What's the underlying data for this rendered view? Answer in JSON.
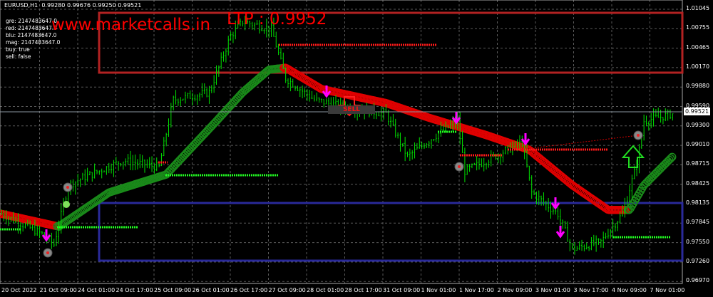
{
  "header": {
    "symbol": "EURUSD,H1",
    "open": "0.99280",
    "high": "0.99676",
    "low": "0.99250",
    "close": "0.99521"
  },
  "indicator_values": [
    "gre: 2147483647.0",
    "red: 2147483647.0",
    "blu: 2147483647.0",
    "mag: 2147483647.0",
    "buy: true",
    "sell: false"
  ],
  "watermark": "www.marketcalls.in",
  "ltp_label": "LTP : 0.9952",
  "sell_label": "SELL",
  "current_price": "0.99521",
  "price_axis": [
    "1.01045",
    "1.00755",
    "1.00465",
    "1.00170",
    "0.99880",
    "0.99590",
    "0.99300",
    "0.99010",
    "0.98715",
    "0.98425",
    "0.98135",
    "0.97845",
    "0.97550",
    "0.97260",
    "0.96970"
  ],
  "time_axis": [
    "20 Oct 2022",
    "21 Oct 09:00",
    "24 Oct 01:00",
    "24 Oct 17:00",
    "25 Oct 09:00",
    "26 Oct 01:00",
    "26 Oct 17:00",
    "27 Oct 09:00",
    "28 Oct 01:00",
    "28 Oct 17:00",
    "31 Oct 09:00",
    "1 Nov 01:00",
    "1 Nov 17:00",
    "2 Nov 09:00",
    "3 Nov 01:00",
    "3 Nov 17:00",
    "4 Nov 09:00",
    "7 Nov 01:00"
  ],
  "colors": {
    "bull": "#00e000",
    "bear": "#00e000",
    "ma_up": "#1a8a1a",
    "ma_down": "#e00000",
    "supply": "#b22222",
    "demand": "#2a2a9a",
    "arrow": "#ff00ff"
  },
  "chart_data": {
    "type": "candlestick",
    "price_path": [
      [
        0,
        0.9798
      ],
      [
        18,
        0.9766
      ],
      [
        22,
        0.9752
      ],
      [
        28,
        0.9841
      ],
      [
        33,
        0.985
      ],
      [
        51,
        0.9878
      ],
      [
        66,
        0.9868
      ],
      [
        72,
        0.9969
      ],
      [
        87,
        0.998
      ],
      [
        96,
        1.0065
      ],
      [
        101,
        1.0086
      ],
      [
        113,
        1.0075
      ],
      [
        119,
        1.0001
      ],
      [
        131,
        0.9969
      ],
      [
        143,
        0.9958
      ],
      [
        161,
        0.9948
      ],
      [
        170,
        0.9884
      ],
      [
        182,
        0.9916
      ],
      [
        191,
        0.9937
      ],
      [
        194,
        0.9862
      ],
      [
        209,
        0.9889
      ],
      [
        218,
        0.9905
      ],
      [
        222,
        0.983
      ],
      [
        233,
        0.9798
      ],
      [
        239,
        0.9745
      ],
      [
        251,
        0.9756
      ],
      [
        260,
        0.9798
      ],
      [
        266,
        0.9873
      ],
      [
        269,
        0.9937
      ],
      [
        281,
        0.9948
      ]
    ],
    "ma_path": [
      [
        0,
        0.9798
      ],
      [
        24,
        0.9779
      ],
      [
        45,
        0.983
      ],
      [
        69,
        0.9857
      ],
      [
        90,
        0.9937
      ],
      [
        101,
        0.998
      ],
      [
        112,
        1.0014
      ],
      [
        119,
        1.0017
      ],
      [
        134,
        0.9985
      ],
      [
        161,
        0.9964
      ],
      [
        179,
        0.9942
      ],
      [
        203,
        0.9916
      ],
      [
        221,
        0.9894
      ],
      [
        239,
        0.9841
      ],
      [
        254,
        0.9804
      ],
      [
        263,
        0.9804
      ],
      [
        269,
        0.9841
      ],
      [
        281,
        0.9884
      ]
    ],
    "ylim": [
      0.9697,
      1.01045
    ]
  }
}
